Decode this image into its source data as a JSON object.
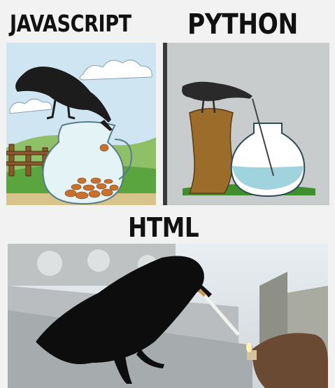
{
  "captions": {
    "javascript": "JAVASCRIPT",
    "python": "PYTHON",
    "html": "HTML"
  },
  "colors": {
    "background": "#f2f2f2",
    "caption_text": "#111111",
    "crow": "#1c1c1c",
    "water": "#9fd3de",
    "stones": "#c8702e",
    "grass": "#3f8f2f"
  }
}
